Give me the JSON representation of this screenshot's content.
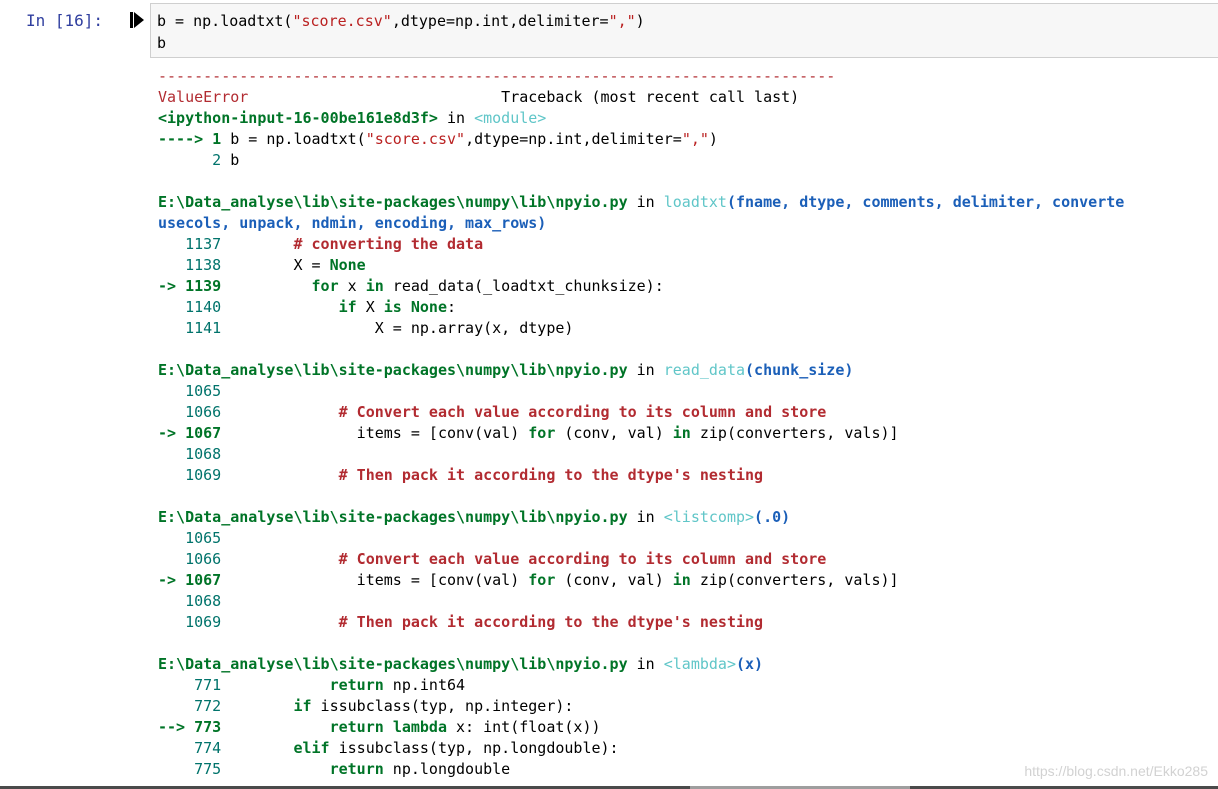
{
  "cell": {
    "prompt": "In  [16]:",
    "code": [
      "b = np.loadtxt(\"score.csv\",dtype=np.int,delimiter=\",\")",
      "b"
    ]
  },
  "traceback": {
    "separator": "---------------------------------------------------------------------------",
    "error_name": "ValueError",
    "header_right": "Traceback (most recent call last)",
    "input_ref": "<ipython-input-16-00be161e8d3f>",
    "in_word": " in ",
    "module": "<module>",
    "arrow1": "----> 1 ",
    "arrow1_code": "b = np.loadtxt(\"score.csv\",dtype=np.int,delimiter=\",\")",
    "line2": "      2 b",
    "frames": [
      {
        "file": "E:\\Data_analyse\\lib\\site-packages\\numpy\\lib\\npyio.py",
        "func": "loadtxt",
        "args": "(fname, dtype, comments, delimiter, converte",
        "args2": "usecols, unpack, ndmin, encoding, max_rows)",
        "lines": [
          {
            "no": "   1137",
            "code": "        # converting the data",
            "type": "comment"
          },
          {
            "no": "   1138",
            "code": "        X = None",
            "type": "normal"
          },
          {
            "no": "-> 1139",
            "code": "          for x in read_data(_loadtxt_chunksize):",
            "type": "current"
          },
          {
            "no": "   1140",
            "code": "             if X is None:",
            "type": "normal"
          },
          {
            "no": "   1141",
            "code": "                 X = np.array(x, dtype)",
            "type": "normal"
          }
        ]
      },
      {
        "file": "E:\\Data_analyse\\lib\\site-packages\\numpy\\lib\\npyio.py",
        "func": "read_data",
        "args": "(chunk_size)",
        "lines": [
          {
            "no": "   1065",
            "code": "",
            "type": "normal"
          },
          {
            "no": "   1066",
            "code": "             # Convert each value according to its column and store",
            "type": "comment"
          },
          {
            "no": "-> 1067",
            "code": "               items = [conv(val) for (conv, val) in zip(converters, vals)]",
            "type": "current"
          },
          {
            "no": "   1068",
            "code": "",
            "type": "normal"
          },
          {
            "no": "   1069",
            "code": "             # Then pack it according to the dtype's nesting",
            "type": "comment"
          }
        ]
      },
      {
        "file": "E:\\Data_analyse\\lib\\site-packages\\numpy\\lib\\npyio.py",
        "func": "<listcomp>",
        "args": "(.0)",
        "lines": [
          {
            "no": "   1065",
            "code": "",
            "type": "normal"
          },
          {
            "no": "   1066",
            "code": "             # Convert each value according to its column and store",
            "type": "comment"
          },
          {
            "no": "-> 1067",
            "code": "               items = [conv(val) for (conv, val) in zip(converters, vals)]",
            "type": "current"
          },
          {
            "no": "   1068",
            "code": "",
            "type": "normal"
          },
          {
            "no": "   1069",
            "code": "             # Then pack it according to the dtype's nesting",
            "type": "comment"
          }
        ]
      },
      {
        "file": "E:\\Data_analyse\\lib\\site-packages\\numpy\\lib\\npyio.py",
        "func": "<lambda>",
        "args": "(x)",
        "lines": [
          {
            "no": "    771",
            "code": "            return np.int64",
            "type": "normal"
          },
          {
            "no": "    772",
            "code": "        if issubclass(typ, np.integer):",
            "type": "normal"
          },
          {
            "no": "--> 773",
            "code": "            return lambda x: int(float(x))",
            "type": "current"
          },
          {
            "no": "    774",
            "code": "        elif issubclass(typ, np.longdouble):",
            "type": "normal"
          },
          {
            "no": "    775",
            "code": "            return np.longdouble",
            "type": "normal"
          }
        ]
      }
    ]
  },
  "watermark": "https://blog.csdn.net/Ekko285",
  "colors": {
    "error_red": "#b22b31",
    "lineno_teal": "#00736b",
    "func_cyan": "#60c6c8",
    "args_blue": "#1b5fb8",
    "prompt_blue": "#303f9f"
  }
}
